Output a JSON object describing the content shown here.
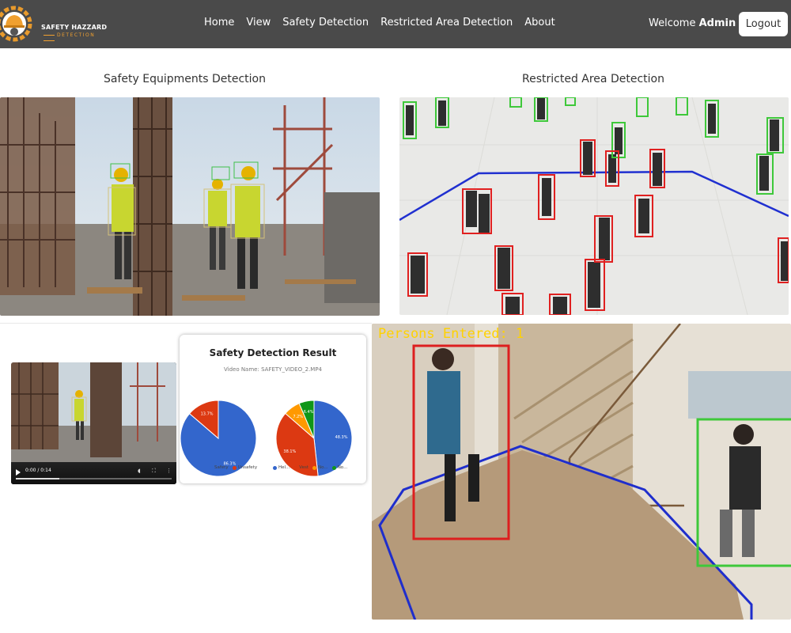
{
  "brand": {
    "line1": "SAFETY HAZZARD",
    "line2": "DETECTION"
  },
  "nav": {
    "links": [
      "Home",
      "View",
      "Safety Detection",
      "Restricted Area Detection",
      "About"
    ]
  },
  "user": {
    "welcome": "Welcome",
    "name": "Admin",
    "logout": "Logout"
  },
  "sections": {
    "safety_title": "Safety Equipments Detection",
    "restricted_title": "Restricted Area Detection"
  },
  "overlay": {
    "persons_entered": "Persons Entered: 1"
  },
  "player": {
    "time": "0:00 / 0:14"
  },
  "result": {
    "title": "Safety Detection Result",
    "video_label": "Video Name:",
    "video_name": "SAFETY_VIDEO_2.MP4"
  },
  "chart_data": [
    {
      "type": "pie",
      "categories": [
        "Safety",
        "Unsafety"
      ],
      "values": [
        86.3,
        13.7
      ],
      "labels": [
        "86.3%",
        "13.7%"
      ],
      "colors": [
        "#3366cc",
        "#dc3912"
      ],
      "legend": "bottom"
    },
    {
      "type": "pie",
      "categories": [
        "Hel...",
        "Vest",
        "No...",
        "No..."
      ],
      "values": [
        48.3,
        38.1,
        7.2,
        6.4
      ],
      "labels": [
        "48.3%",
        "38.1%",
        "7.2%",
        "6.4%"
      ],
      "colors": [
        "#3366cc",
        "#dc3912",
        "#ff9900",
        "#109618"
      ],
      "legend": "bottom"
    }
  ]
}
